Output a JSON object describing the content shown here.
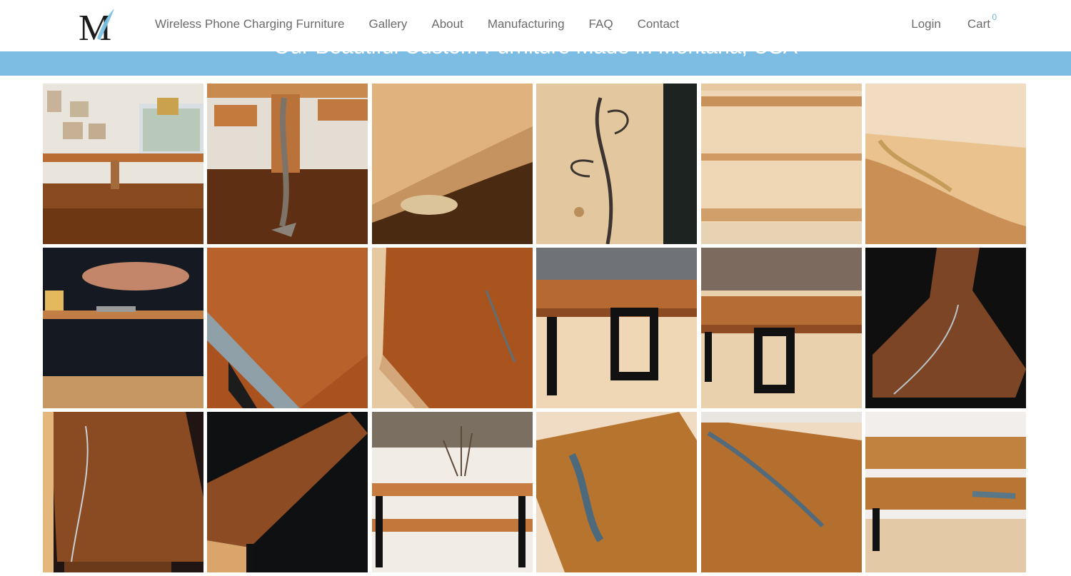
{
  "brand": {
    "logo_letter": "M"
  },
  "nav": {
    "items": [
      {
        "label": "Wireless Phone Charging Furniture"
      },
      {
        "label": "Gallery"
      },
      {
        "label": "About"
      },
      {
        "label": "Manufacturing"
      },
      {
        "label": "FAQ"
      },
      {
        "label": "Contact"
      }
    ],
    "login_label": "Login",
    "cart_label": "Cart",
    "cart_count": "0"
  },
  "banner": {
    "title": "Our Beautiful Custom Furniture Made in Montana, USA",
    "color": "#7dbde3"
  },
  "colors": {
    "accent": "#6fb6de",
    "nav_text": "#6b6b6b"
  },
  "gallery": {
    "columns": 6,
    "photos": [
      {
        "kind": "room"
      },
      {
        "kind": "leg"
      },
      {
        "kind": "edge-closeup"
      },
      {
        "kind": "ironwork"
      },
      {
        "kind": "shelves"
      },
      {
        "kind": "corner-top"
      },
      {
        "kind": "fish-console"
      },
      {
        "kind": "cherry-slab"
      },
      {
        "kind": "cherry-slab-2"
      },
      {
        "kind": "bench-showroom"
      },
      {
        "kind": "bench-showroom-2"
      },
      {
        "kind": "walnut-dark"
      },
      {
        "kind": "walnut-closeup"
      },
      {
        "kind": "walnut-angle"
      },
      {
        "kind": "console-shelf"
      },
      {
        "kind": "epoxy-slab"
      },
      {
        "kind": "epoxy-slab-2"
      },
      {
        "kind": "two-tier-table"
      }
    ]
  }
}
